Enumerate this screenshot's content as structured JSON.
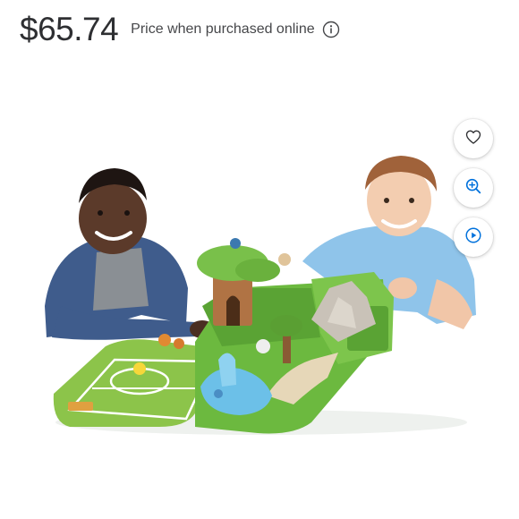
{
  "price": {
    "amount": "$65.74",
    "note": "Price when purchased online"
  },
  "icons": {
    "info": "info-icon",
    "favorite": "heart-icon",
    "zoom": "zoom-in-icon",
    "video": "play-icon"
  },
  "colors": {
    "accent": "#0071dc",
    "text": "#2e2f32",
    "muted": "#46474a"
  }
}
